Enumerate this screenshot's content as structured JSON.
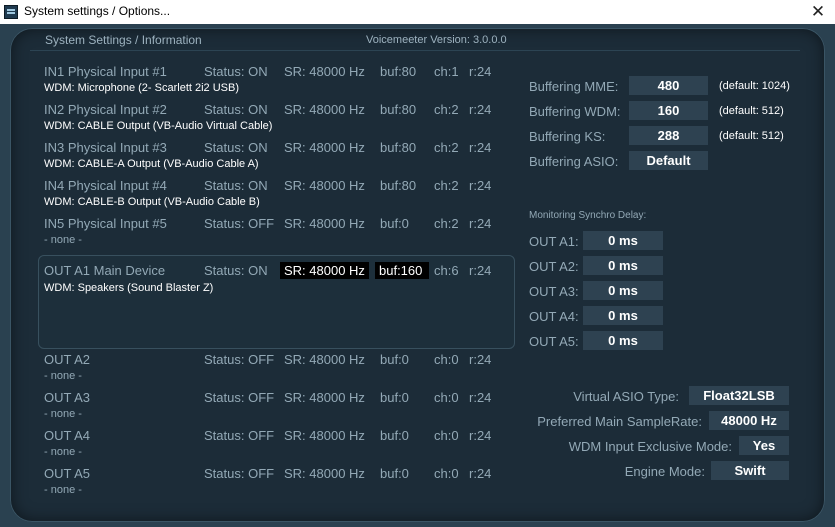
{
  "window": {
    "title": "System settings / Options...",
    "close_icon": "close-icon"
  },
  "header": {
    "left": "System Settings / Information",
    "right": "Voicemeeter Version: 3.0.0.0"
  },
  "inputs": [
    {
      "name": "IN1 Physical Input #1",
      "status": "Status: ON",
      "sr": "SR: 48000 Hz",
      "buf": "buf:80",
      "ch": "ch:1",
      "r": "r:24",
      "device": "WDM: Microphone (2- Scarlett 2i2 USB)"
    },
    {
      "name": "IN2 Physical Input #2",
      "status": "Status: ON",
      "sr": "SR: 48000 Hz",
      "buf": "buf:80",
      "ch": "ch:2",
      "r": "r:24",
      "device": "WDM: CABLE Output (VB-Audio Virtual Cable)"
    },
    {
      "name": "IN3 Physical Input #3",
      "status": "Status: ON",
      "sr": "SR: 48000 Hz",
      "buf": "buf:80",
      "ch": "ch:2",
      "r": "r:24",
      "device": "WDM: CABLE-A Output (VB-Audio Cable A)"
    },
    {
      "name": "IN4 Physical Input #4",
      "status": "Status: ON",
      "sr": "SR: 48000 Hz",
      "buf": "buf:80",
      "ch": "ch:2",
      "r": "r:24",
      "device": "WDM: CABLE-B Output (VB-Audio Cable B)"
    },
    {
      "name": "IN5 Physical Input #5",
      "status": "Status: OFF",
      "sr": "SR: 48000 Hz",
      "buf": "buf:0",
      "ch": "ch:2",
      "r": "r:24",
      "device": "- none -"
    }
  ],
  "main_out": {
    "name": "OUT A1 Main Device",
    "status": "Status: ON",
    "sr": "SR: 48000 Hz",
    "buf": "buf:160",
    "ch": "ch:6",
    "r": "r:24",
    "device": "WDM: Speakers (Sound Blaster Z)"
  },
  "outputs": [
    {
      "name": "OUT A2",
      "status": "Status: OFF",
      "sr": "SR: 48000 Hz",
      "buf": "buf:0",
      "ch": "ch:0",
      "r": "r:24",
      "device": "- none -"
    },
    {
      "name": "OUT A3",
      "status": "Status: OFF",
      "sr": "SR: 48000 Hz",
      "buf": "buf:0",
      "ch": "ch:0",
      "r": "r:24",
      "device": "- none -"
    },
    {
      "name": "OUT A4",
      "status": "Status: OFF",
      "sr": "SR: 48000 Hz",
      "buf": "buf:0",
      "ch": "ch:0",
      "r": "r:24",
      "device": "- none -"
    },
    {
      "name": "OUT A5",
      "status": "Status: OFF",
      "sr": "SR: 48000 Hz",
      "buf": "buf:0",
      "ch": "ch:0",
      "r": "r:24",
      "device": "- none -"
    }
  ],
  "buffering": [
    {
      "label": "Buffering MME:",
      "value": "480",
      "default": "(default: 1024)"
    },
    {
      "label": "Buffering WDM:",
      "value": "160",
      "default": "(default: 512)"
    },
    {
      "label": "Buffering KS:",
      "value": "288",
      "default": "(default: 512)"
    },
    {
      "label": "Buffering ASIO:",
      "value": "Default",
      "default": ""
    }
  ],
  "monitoring": {
    "title": "Monitoring Synchro Delay:",
    "items": [
      {
        "label": "OUT A1:",
        "value": "0 ms"
      },
      {
        "label": "OUT A2:",
        "value": "0 ms"
      },
      {
        "label": "OUT A3:",
        "value": "0 ms"
      },
      {
        "label": "OUT A4:",
        "value": "0 ms"
      },
      {
        "label": "OUT A5:",
        "value": "0 ms"
      }
    ]
  },
  "settings": [
    {
      "label": "Virtual ASIO Type:",
      "value": "Float32LSB"
    },
    {
      "label": "Preferred Main SampleRate:",
      "value": "48000 Hz"
    },
    {
      "label": "WDM Input Exclusive Mode:",
      "value": "Yes"
    },
    {
      "label": "Engine Mode:",
      "value": "Swift"
    }
  ]
}
